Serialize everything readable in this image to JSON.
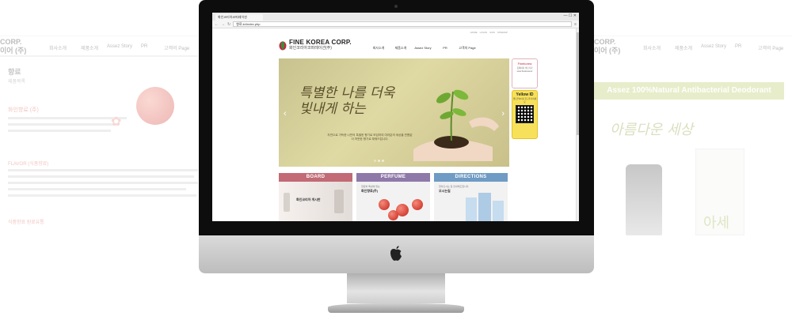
{
  "browser": {
    "tab_title": "화인코리아코퍼레이션",
    "url": "향료.kr/index.php",
    "window_controls": "— ☐ ✕"
  },
  "site": {
    "util_links": [
      "HOME",
      "LOGIN",
      "JOIN",
      "SITEMAP"
    ],
    "logo_title": "FINE KOREA CORP.",
    "logo_sub": "화인코리아코퍼레이션(주)",
    "nav": [
      "회사소개",
      "제품소개",
      "Assez Story",
      "PR",
      "고객의 Page"
    ],
    "hero": {
      "headline": "특별한 나를 더욱 빛내게 하는",
      "body": "자연으로 가득한 나만의 특별한 향기로 보답하여 여러분의 세상을 빈틈없이 따뜻한 향기로 채워드립니다."
    },
    "side": {
      "finekorea_title": "Finekorea",
      "finekorea_sub": "홈페이지 바로가기 www.finekorea.kr",
      "yellowid_title": "Yellow ID",
      "yellowid_sub": "옐로우아이디 친구추가하세요"
    },
    "cards": {
      "board_title": "BOARD",
      "board_text": "화인코리아 게시판",
      "perfume_title": "PERFUME",
      "perfume_caption": "향료와 특성에 맞는",
      "perfume_text": "화인향료(주)",
      "directions_title": "DIRECTIONS",
      "directions_caption": "찾아오시는 길 안내해드립니다.",
      "directions_text": "오시는길"
    }
  },
  "bg_left": {
    "brand_line1": "CORP.",
    "brand_line2": "이어 (주)",
    "nav": [
      "회사소개",
      "제품소개",
      "Assez Story",
      "PR",
      "고객의 Page"
    ],
    "section_title": "향료",
    "section_sub": "제품목록",
    "red_title": "화인향료 (주)",
    "red_title2": "FLAVOR (식품향료)",
    "red_footer": "식품향료 원료유통"
  },
  "bg_right": {
    "brand_line1": "CORP.",
    "brand_line2": "이어 (주)",
    "nav": [
      "회사소개",
      "제품소개",
      "Assez Story",
      "PR",
      "고객의 Page"
    ],
    "banner": "Assez 100%Natural Antibacterial Deodorant",
    "calligraphy": "아름다운 세상",
    "bottle_label": "아세"
  },
  "colors": {
    "board": "#c26a75",
    "perfume": "#8f79a9",
    "directions": "#6f9bc4",
    "hero": "#d6d09a",
    "banner_green": "#c7d97a"
  }
}
